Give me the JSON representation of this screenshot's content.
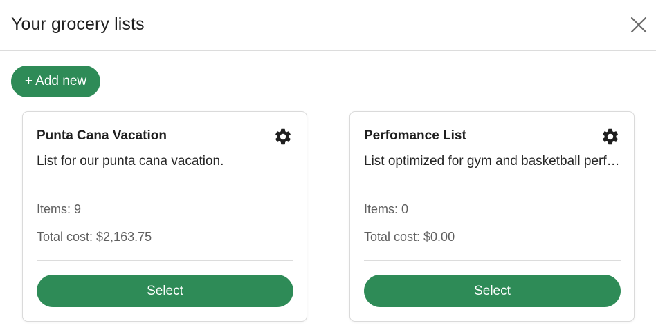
{
  "header": {
    "title": "Your grocery lists",
    "close_icon": "close-icon"
  },
  "toolbar": {
    "add_label": "+ Add new"
  },
  "colors": {
    "accent": "#2e8b57",
    "divider": "#dcdcdc"
  },
  "lists": [
    {
      "name": "Punta Cana Vacation",
      "description": "List for our punta cana vacation.",
      "items": "Items: 9",
      "total": "Total cost: $2,163.75",
      "settings_icon": "gear-icon",
      "select_label": "Select"
    },
    {
      "name": "Perfomance List",
      "description": "List optimized for gym and basketball performance",
      "items": "Items: 0",
      "total": "Total cost: $0.00",
      "settings_icon": "gear-icon",
      "select_label": "Select"
    }
  ]
}
